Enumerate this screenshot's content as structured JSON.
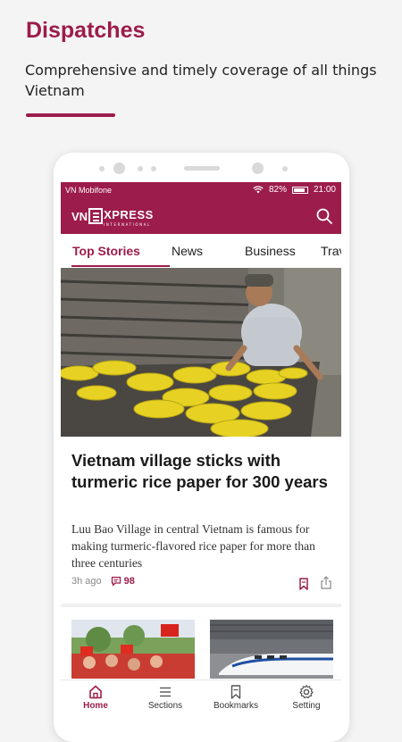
{
  "promo": {
    "title": "Dispatches",
    "subtitle": "Comprehensive and timely coverage of all things Vietnam"
  },
  "status_bar": {
    "carrier": "VN Mobifone",
    "battery": "82%",
    "time": "21:00"
  },
  "app_bar": {
    "logo_vn": "VN",
    "logo_xpress": "XPRESS",
    "logo_intl": "INTERNATIONAL"
  },
  "tabs": [
    {
      "label": "Top Stories",
      "active": true
    },
    {
      "label": "News"
    },
    {
      "label": "Business"
    },
    {
      "label": "Travel"
    }
  ],
  "article": {
    "headline": "Vietnam village sticks with turmeric rice paper for 300 years",
    "lead": "Luu Bao Village in central Vietnam is famous for making turmeric-flavored rice paper for more than three centuries",
    "time_ago": "3h ago",
    "comments": "98"
  },
  "bottom_nav": [
    {
      "label": "Home",
      "icon": "home-icon",
      "active": true
    },
    {
      "label": "Sections",
      "icon": "menu-icon"
    },
    {
      "label": "Bookmarks",
      "icon": "bookmark-icon"
    },
    {
      "label": "Setting",
      "icon": "gear-icon"
    }
  ],
  "colors": {
    "accent": "#9c1c4b",
    "background": "#f4f4f4"
  }
}
